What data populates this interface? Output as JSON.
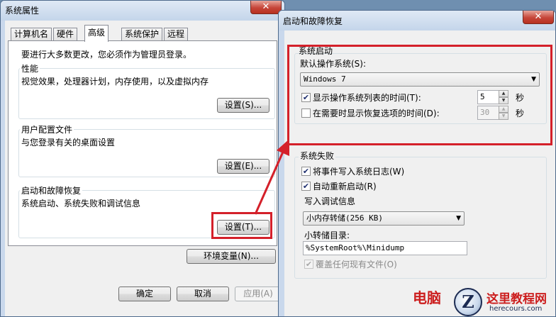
{
  "sysprops": {
    "title": "系统属性",
    "tabs": [
      "计算机名",
      "硬件",
      "高级",
      "系统保护",
      "远程"
    ],
    "admin_note": "要进行大多数更改，您必须作为管理员登录。",
    "performance": {
      "title": "性能",
      "desc": "视觉效果，处理器计划，内存使用，以及虚拟内存",
      "button": "设置(S)..."
    },
    "user_profiles": {
      "title": "用户配置文件",
      "desc": "与您登录有关的桌面设置",
      "button": "设置(E)..."
    },
    "startup_recovery": {
      "title": "启动和故障恢复",
      "desc": "系统启动、系统失败和调试信息",
      "button": "设置(T)..."
    },
    "env_button": "环境变量(N)...",
    "ok": "确定",
    "cancel": "取消",
    "apply": "应用(A)"
  },
  "recovery": {
    "title": "启动和故障恢复",
    "system_startup": {
      "title": "系统启动",
      "default_os_label": "默认操作系统(S):",
      "default_os_value": "Windows 7",
      "show_list_label": "显示操作系统列表的时间(T):",
      "show_list_checked": true,
      "show_list_value": "5",
      "show_recovery_label": "在需要时显示恢复选项的时间(D):",
      "show_recovery_checked": false,
      "show_recovery_value": "30",
      "seconds": "秒"
    },
    "system_failure": {
      "title": "系统失败",
      "write_log_label": "将事件写入系统日志(W)",
      "write_log_checked": true,
      "auto_restart_label": "自动重新启动(R)",
      "auto_restart_checked": true,
      "debug_title": "写入调试信息",
      "debug_value": "小内存转储(256 KB)",
      "dump_dir_label": "小转储目录:",
      "dump_dir_value": "%SystemRoot%\\Minidump",
      "overwrite_label": "覆盖任何现有文件(O)",
      "overwrite_checked": true
    }
  },
  "watermark": {
    "left_text": "电脑",
    "site_name": "这里教程网",
    "site_url": "herecours.com"
  },
  "colors": {
    "highlight_red": "#d4202a",
    "window_bg": "#f0f0f0"
  }
}
